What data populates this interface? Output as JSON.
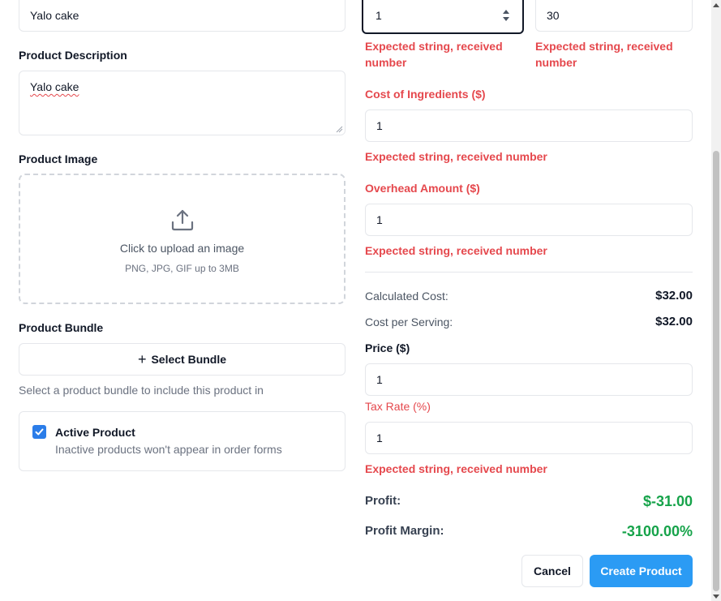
{
  "left": {
    "name_value": "Yalo cake",
    "description_label": "Product Description",
    "description_value": "Yalo cake",
    "image_label": "Product Image",
    "upload_title": "Click to upload an image",
    "upload_hint": "PNG, JPG, GIF up to 3MB",
    "bundle_label": "Product Bundle",
    "bundle_button": "Select Bundle",
    "bundle_help": "Select a product bundle to include this product in",
    "active_title": "Active Product",
    "active_desc": "Inactive products won't appear in order forms",
    "active_checked": true
  },
  "right": {
    "servings_value": "1",
    "field2_value": "30",
    "error_text_1": "Expected string, received number",
    "error_text_2": "Expected string, received number",
    "cost_label": "Cost of Ingredients ($)",
    "cost_value": "1",
    "cost_error": "Expected string, received number",
    "overhead_label": "Overhead Amount ($)",
    "overhead_value": "1",
    "overhead_error": "Expected string, received number",
    "calc_cost_label": "Calculated Cost:",
    "calc_cost_value": "$32.00",
    "cost_per_serving_label": "Cost per Serving:",
    "cost_per_serving_value": "$32.00",
    "price_label": "Price ($)",
    "price_value": "1",
    "tax_label": "Tax Rate (%)",
    "tax_value": "1",
    "tax_error": "Expected string, received number",
    "profit_label": "Profit:",
    "profit_value": "$-31.00",
    "margin_label": "Profit Margin:",
    "margin_value": "-3100.00%"
  },
  "actions": {
    "cancel": "Cancel",
    "create": "Create Product"
  },
  "colors": {
    "error": "#e5484d",
    "primary": "#2b9bf4",
    "profit": "#16a34a"
  }
}
